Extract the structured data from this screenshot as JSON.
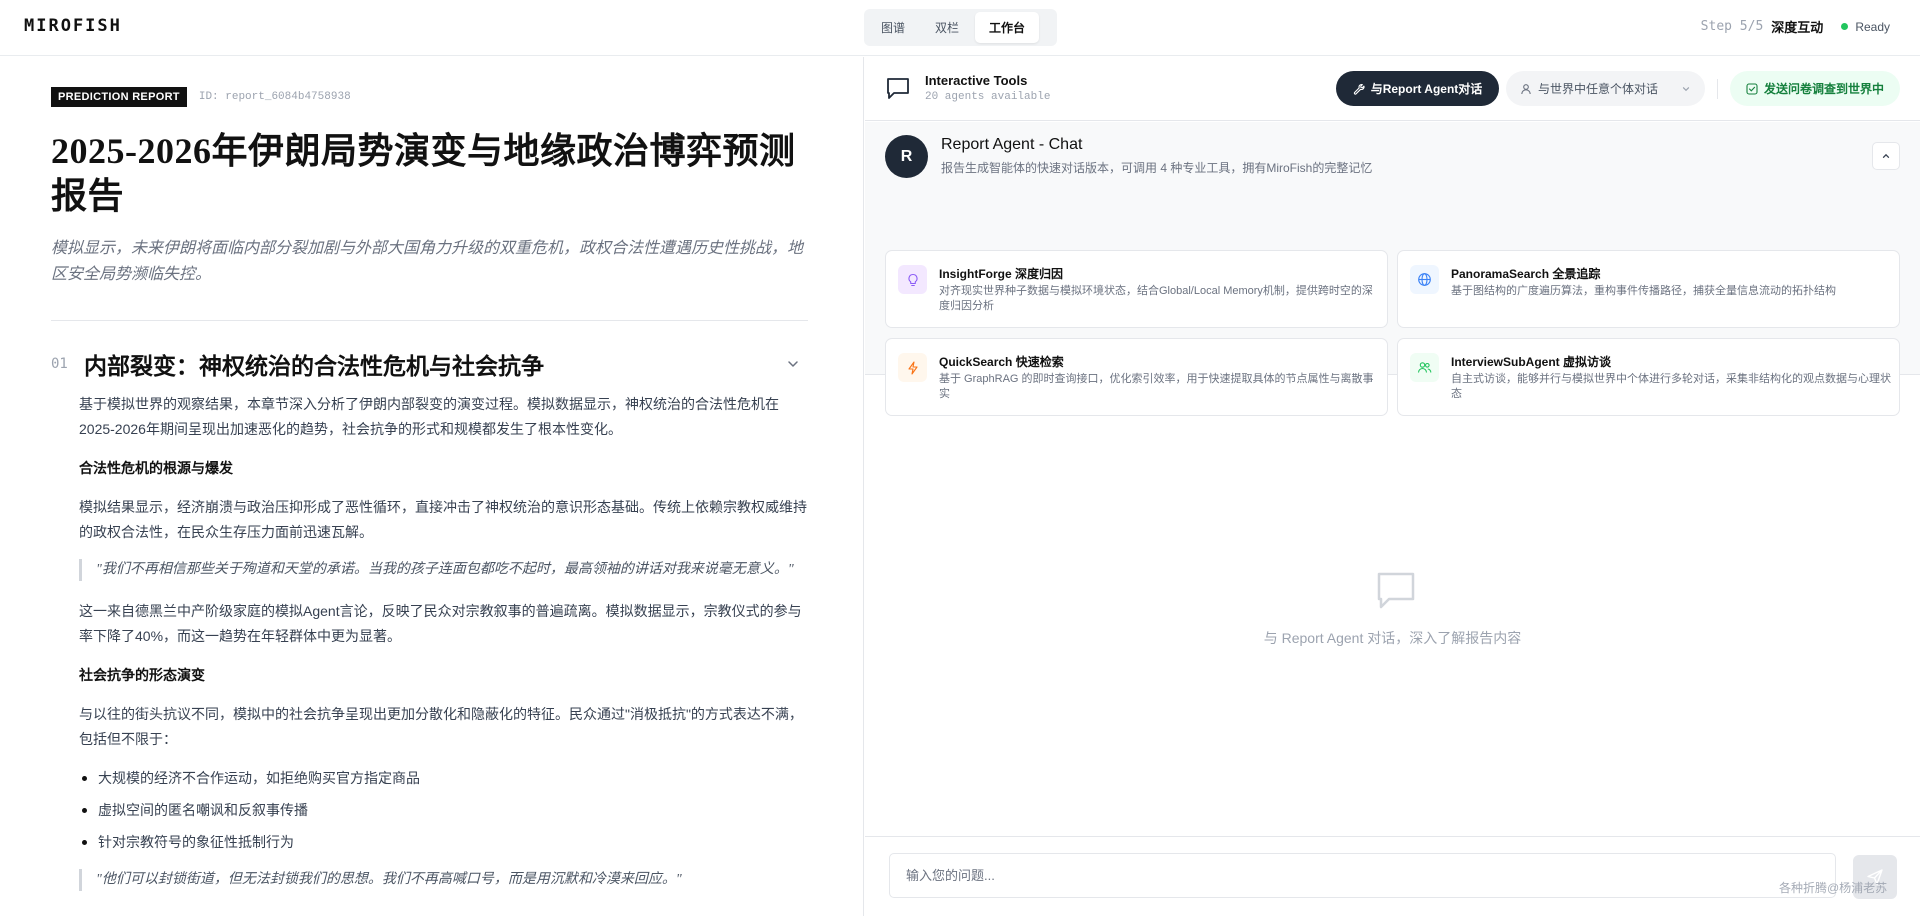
{
  "app": {
    "brand": "MIROFISH"
  },
  "view_switch": {
    "tabs": [
      "图谱",
      "双栏",
      "工作台"
    ],
    "active": "工作台"
  },
  "step": {
    "label": "Step 5/5",
    "name": "深度互动",
    "status": "Ready",
    "status_color": "#22c55e"
  },
  "report": {
    "badge": "PREDICTION REPORT",
    "id": "ID: report_6084b4758938",
    "title": "2025-2026年伊朗局势演变与地缘政治博弈预测报告",
    "subtitle": "模拟显示，未来伊朗将面临内部分裂加剧与外部大国角力升级的双重危机，政权合法性遭遇历史性挑战，地区安全局势濒临失控。",
    "section": {
      "num": "01",
      "title": "内部裂变：神权统治的合法性危机与社会抗争",
      "p1": "基于模拟世界的观察结果，本章节深入分析了伊朗内部裂变的演变过程。模拟数据显示，神权统治的合法性危机在2025-2026年期间呈现出加速恶化的趋势，社会抗争的形式和规模都发生了根本性变化。",
      "h1": "合法性危机的根源与爆发",
      "p2": "模拟结果显示，经济崩溃与政治压抑形成了恶性循环，直接冲击了神权统治的意识形态基础。传统上依赖宗教权威维持的政权合法性，在民众生存压力面前迅速瓦解。",
      "quote1": "\"我们不再相信那些关于殉道和天堂的承诺。当我的孩子连面包都吃不起时，最高领袖的讲话对我来说毫无意义。\"",
      "p3": "这一来自德黑兰中产阶级家庭的模拟Agent言论，反映了民众对宗教叙事的普遍疏离。模拟数据显示，宗教仪式的参与率下降了40%，而这一趋势在年轻群体中更为显著。",
      "h2": "社会抗争的形态演变",
      "p4": "与以往的街头抗议不同，模拟中的社会抗争呈现出更加分散化和隐蔽化的特征。民众通过\"消极抵抗\"的方式表达不满，包括但不限于：",
      "bullets": [
        "大规模的经济不合作运动，如拒绝购买官方指定商品",
        "虚拟空间的匿名嘲讽和反叙事传播",
        "针对宗教符号的象征性抵制行为"
      ],
      "quote2": "\"他们可以封锁街道，但无法封锁我们的思想。我们不再高喊口号，而是用沉默和冷漠来回应。\""
    }
  },
  "tools_bar": {
    "title": "Interactive Tools",
    "sub": "20 agents available",
    "btn_report": "与Report Agent对话",
    "btn_world": "与世界中任意个体对话",
    "btn_survey": "发送问卷调查到世界中",
    "accent": "#1f2937",
    "survey_color": "#15803d"
  },
  "agent": {
    "avatar": "R",
    "name": "Report Agent - Chat",
    "desc": "报告生成智能体的快速对话版本，可调用 4 种专业工具，拥有MiroFish的完整记忆",
    "tools": [
      {
        "name": "InsightForge 深度归因",
        "desc": "对齐现实世界种子数据与模拟环境状态，结合Global/Local Memory机制，提供跨时空的深度归因分析",
        "icon": "lightbulb-icon",
        "color": "#8b5cf6",
        "bg": "#f3e8ff"
      },
      {
        "name": "PanoramaSearch 全景追踪",
        "desc": "基于图结构的广度遍历算法，重构事件传播路径，捕获全量信息流动的拓扑结构",
        "icon": "globe-icon",
        "color": "#3b82f6",
        "bg": "#eff6ff"
      },
      {
        "name": "QuickSearch 快速检索",
        "desc": "基于 GraphRAG 的即时查询接口，优化索引效率，用于快速提取具体的节点属性与离散事实",
        "icon": "lightning-icon",
        "color": "#f97316",
        "bg": "#fff7ed"
      },
      {
        "name": "InterviewSubAgent 虚拟访谈",
        "desc": "自主式访谈，能够并行与模拟世界中个体进行多轮对话，采集非结构化的观点数据与心理状态",
        "icon": "users-icon",
        "color": "#22c55e",
        "bg": "#f0fdf4"
      }
    ]
  },
  "chat": {
    "empty_text": "与 Report Agent 对话，深入了解报告内容",
    "placeholder": "输入您的问题..."
  },
  "watermark": "各种折腾@杨浦老苏"
}
